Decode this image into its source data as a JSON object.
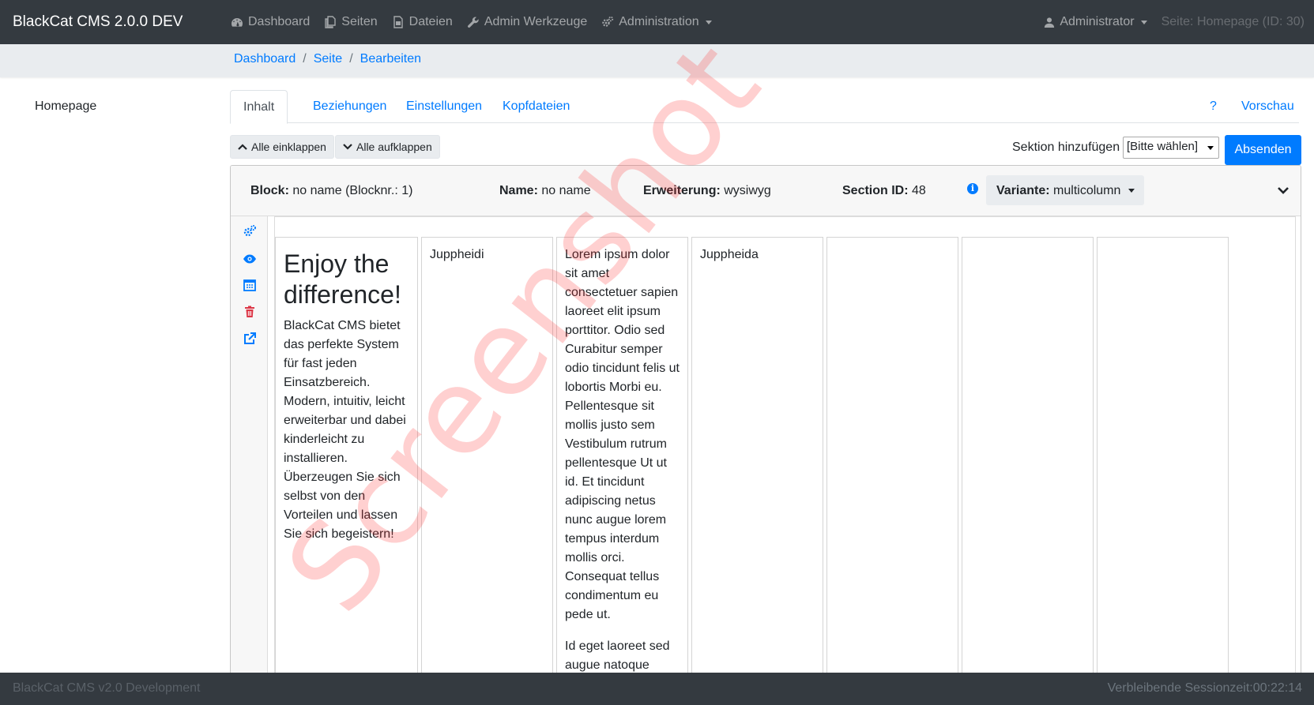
{
  "navbar": {
    "brand": "BlackCat CMS 2.0.0 DEV",
    "items": [
      {
        "label": "Dashboard",
        "icon": "dashboard-icon"
      },
      {
        "label": "Seiten",
        "icon": "pages-icon"
      },
      {
        "label": "Dateien",
        "icon": "files-icon"
      },
      {
        "label": "Admin Werkzeuge",
        "icon": "wrench-icon"
      },
      {
        "label": "Administration",
        "icon": "gears-icon"
      }
    ],
    "user": "Administrator",
    "page_info": "Seite: Homepage (ID: 30)"
  },
  "breadcrumb": [
    "Dashboard",
    "Seite",
    "Bearbeiten"
  ],
  "pagetree": {
    "item": "Homepage"
  },
  "tabs": [
    "Inhalt",
    "Beziehungen",
    "Einstellungen",
    "Kopfdateien"
  ],
  "tabs_right": {
    "help": "?",
    "preview": "Vorschau"
  },
  "toolbar": {
    "collapse_all": "Alle einklappen",
    "expand_all": "Alle aufklappen",
    "add_section_label": "Sektion hinzufügen",
    "add_section_value": "[Bitte wählen]",
    "submit": "Absenden"
  },
  "block": {
    "block_label": "Block:",
    "block_value": "no name (Blocknr.: 1)",
    "name_label": "Name:",
    "name_value": "no name",
    "ext_label": "Erweiterung:",
    "ext_value": "wysiwyg",
    "section_label": "Section ID:",
    "section_value": "48",
    "variant_label": "Variante:",
    "variant_value": "multicolumn"
  },
  "columns": {
    "c1_heading": "Enjoy the difference!",
    "c1_text": "BlackCat CMS bietet das perfekte System für fast jeden Einsatzbereich. Modern, intuitiv, leicht erweiterbar und dabei kinderleicht zu installieren. Überzeugen Sie sich selbst von den Vorteilen und lassen Sie sich begeistern!",
    "c2_text": "Juppheidi",
    "c3_p1": "Lorem ipsum dolor sit amet consectetuer sapien laoreet elit ipsum porttitor. Odio sed Curabitur semper odio tincidunt felis ut lobortis Morbi eu. Pellentesque sit mollis justo sem Vestibulum rutrum pellentesque Ut ut id. Et tincidunt adipiscing netus nunc augue lorem tempus interdum mollis orci. Consequat tellus condimentum eu pede ut.",
    "c3_p2": "Id eget laoreet sed augue natoque sollicitudin lobortis ut Lorem Integer. Et vel",
    "c4_text": "Juppheida"
  },
  "footer": {
    "left": "BlackCat CMS v2.0 Development",
    "right": "Verbleibende Sessionzeit:00:22:14"
  },
  "watermark": "Screenshot",
  "colors": {
    "navbar": "#343a40",
    "link": "#007bff",
    "danger": "#dc3545"
  }
}
